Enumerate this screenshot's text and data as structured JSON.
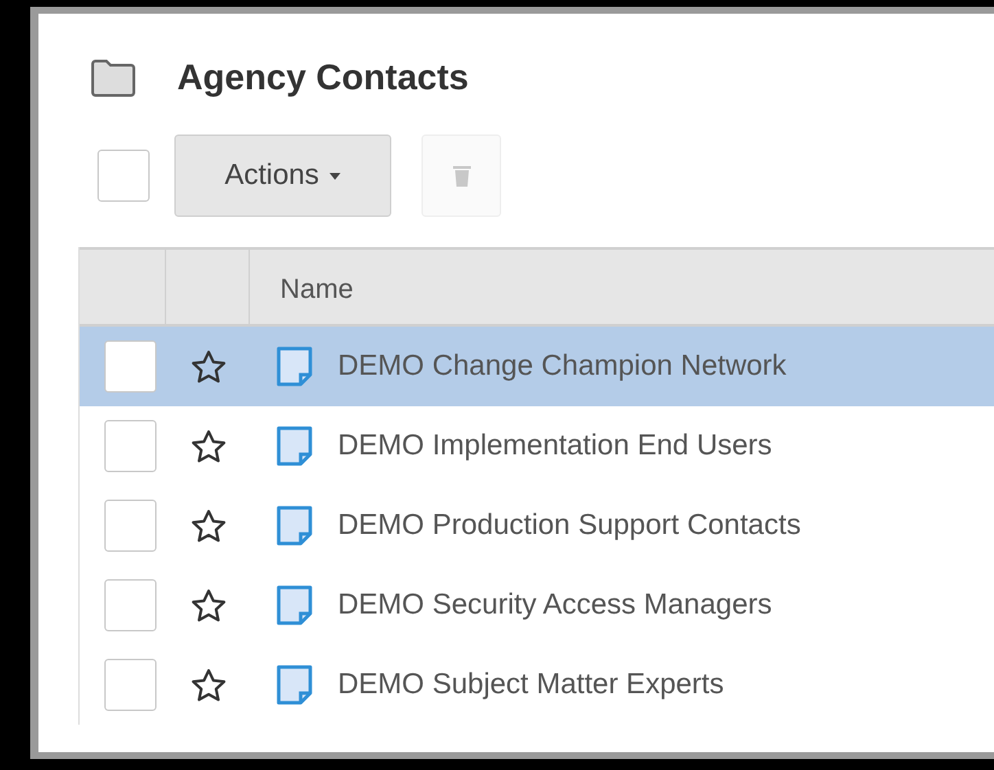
{
  "header": {
    "title": "Agency Contacts"
  },
  "toolbar": {
    "select_all": {
      "checked": false
    },
    "actions_label": "Actions",
    "delete": {
      "disabled": true
    }
  },
  "table": {
    "columns": [
      "Name"
    ],
    "rows": [
      {
        "name": "DEMO Change Champion Network",
        "selected": true,
        "checked": false,
        "starred": false
      },
      {
        "name": "DEMO Implementation End Users",
        "selected": false,
        "checked": false,
        "starred": false
      },
      {
        "name": "DEMO Production Support Contacts",
        "selected": false,
        "checked": false,
        "starred": false
      },
      {
        "name": "DEMO Security Access Managers",
        "selected": false,
        "checked": false,
        "starred": false
      },
      {
        "name": "DEMO Subject Matter Experts",
        "selected": false,
        "checked": false,
        "starred": false
      }
    ]
  }
}
